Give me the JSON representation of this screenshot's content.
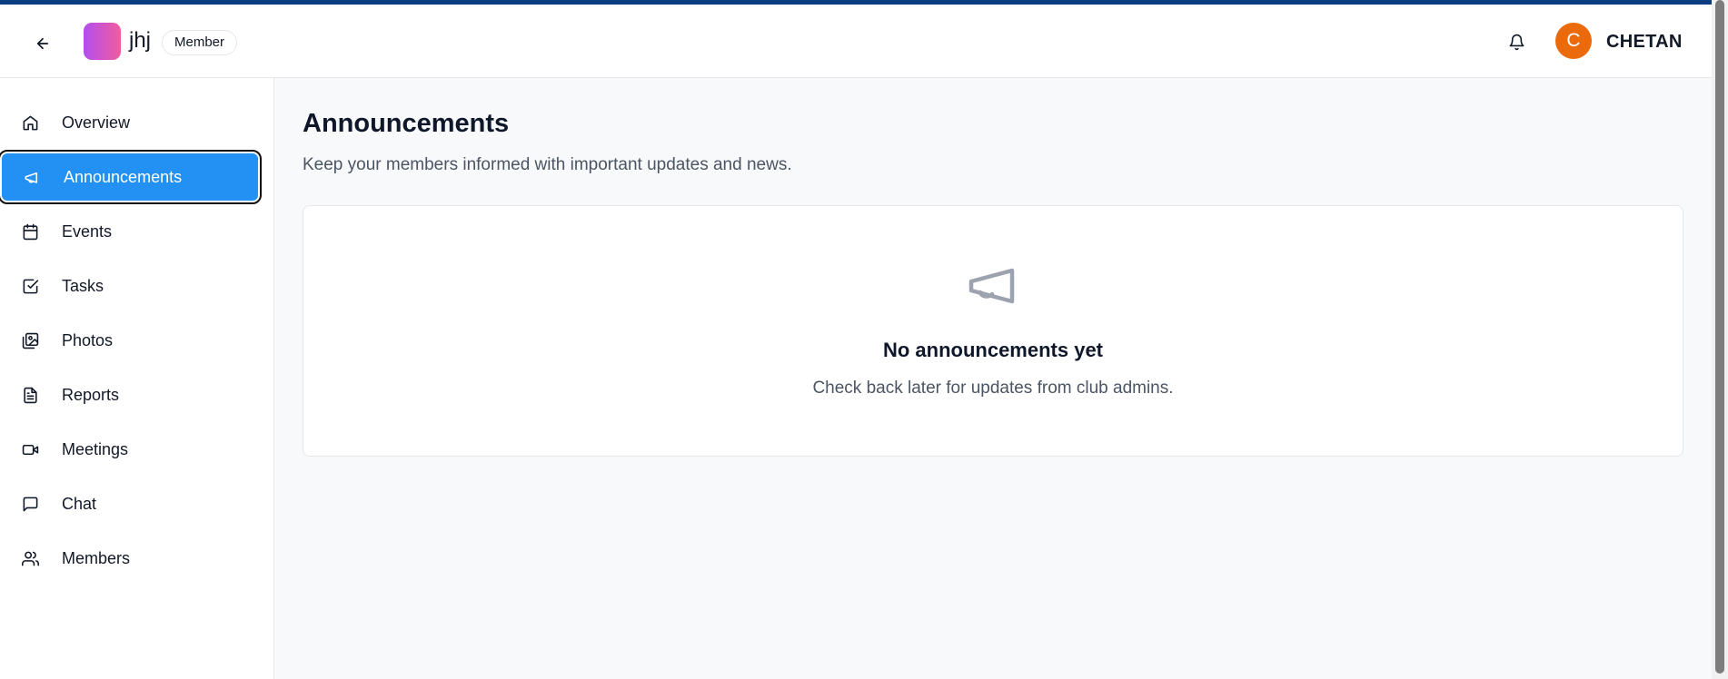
{
  "header": {
    "back_icon": "arrow-left-icon",
    "club_name": "jhj",
    "role_badge": "Member",
    "bell_icon": "bell-icon",
    "avatar_initial": "C",
    "avatar_color": "#ea6a0c",
    "username": "CHETAN"
  },
  "sidebar": {
    "active_color": "#2391f3",
    "items": [
      {
        "label": "Overview",
        "icon": "home-icon"
      },
      {
        "label": "Announcements",
        "icon": "megaphone-icon"
      },
      {
        "label": "Events",
        "icon": "calendar-icon"
      },
      {
        "label": "Tasks",
        "icon": "checkbox-icon"
      },
      {
        "label": "Photos",
        "icon": "images-icon"
      },
      {
        "label": "Reports",
        "icon": "document-icon"
      },
      {
        "label": "Meetings",
        "icon": "video-icon"
      },
      {
        "label": "Chat",
        "icon": "chat-icon"
      },
      {
        "label": "Members",
        "icon": "users-icon"
      }
    ]
  },
  "main": {
    "title": "Announcements",
    "subtitle": "Keep your members informed with important updates and news.",
    "empty_state": {
      "icon": "megaphone-icon",
      "title": "No announcements yet",
      "message": "Check back later for updates from club admins."
    }
  }
}
